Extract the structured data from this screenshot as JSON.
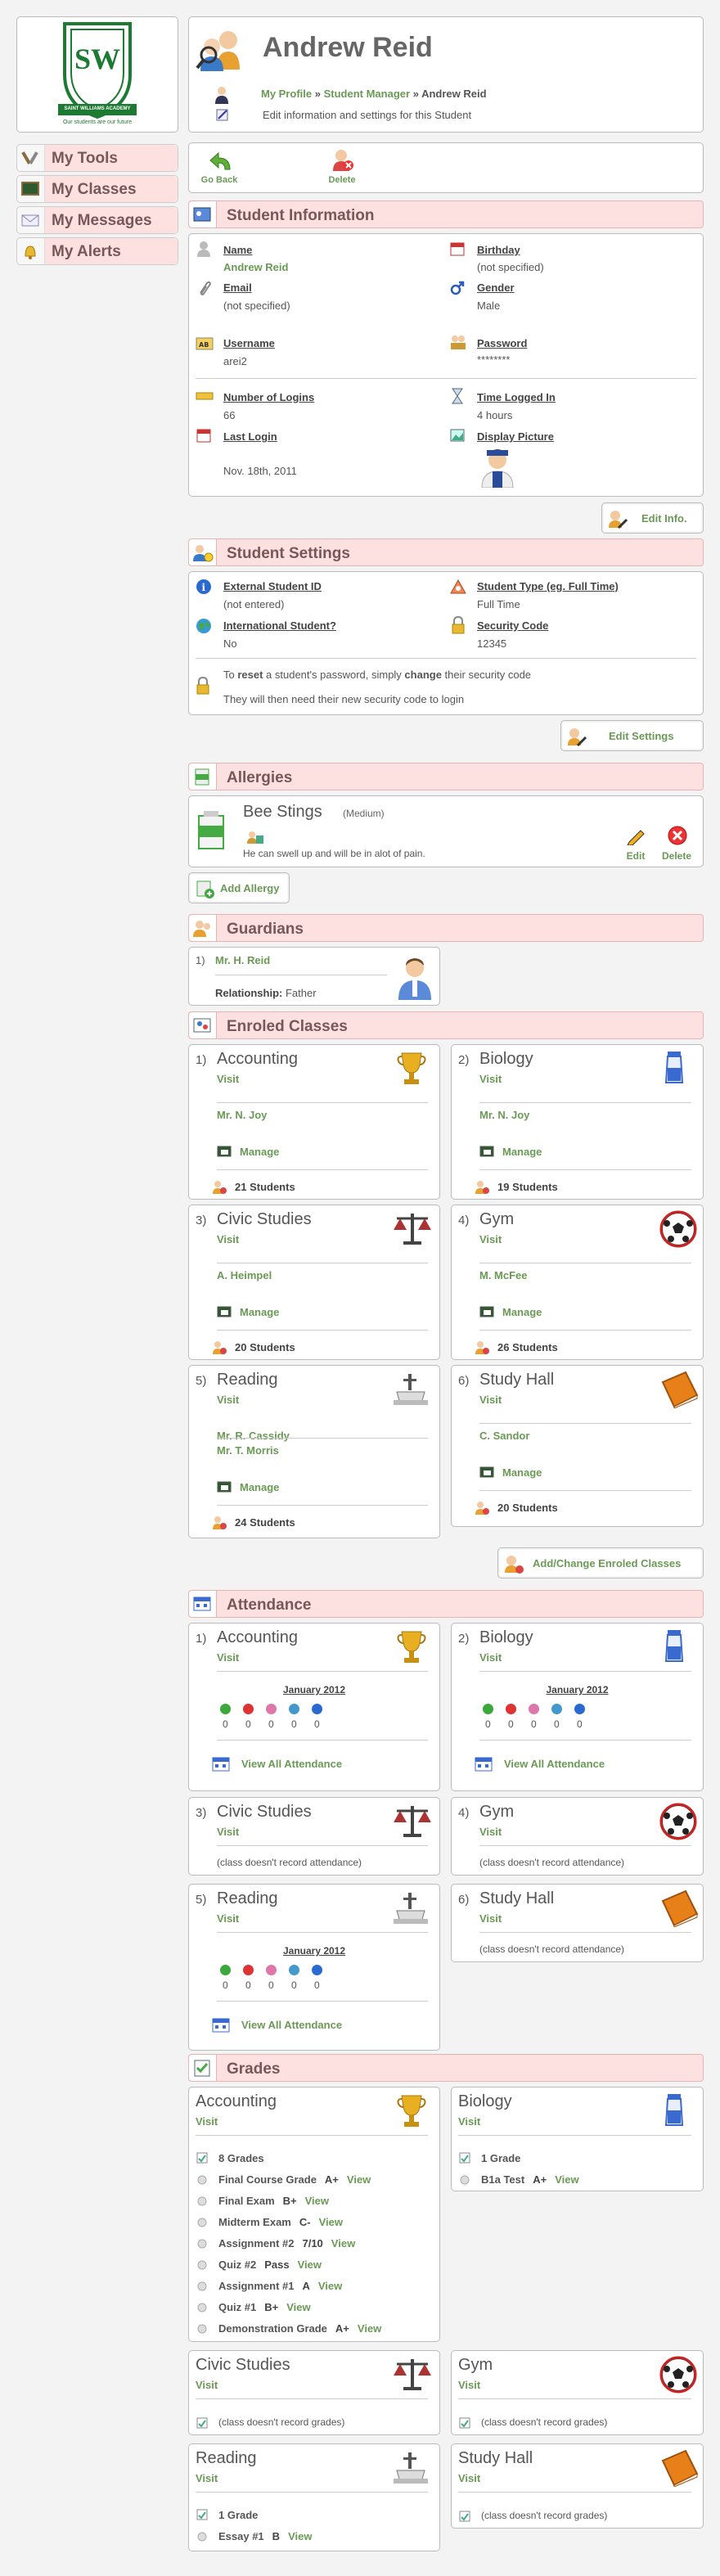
{
  "logo": {
    "letters": "SW",
    "banner": "SAINT WILLIAMS ACADEMY",
    "motto": "Our students are our future"
  },
  "nav": [
    {
      "label": "My Tools",
      "icon": "tools-icon"
    },
    {
      "label": "My Classes",
      "icon": "chalkboard-icon"
    },
    {
      "label": "My Messages",
      "icon": "envelope-icon"
    },
    {
      "label": "My Alerts",
      "icon": "bell-icon"
    }
  ],
  "header": {
    "name": "Andrew Reid",
    "breadcrumb": {
      "a": "My Profile",
      "sep1": "»",
      "b": "Student Manager",
      "sep2": "»",
      "c": "Andrew Reid"
    },
    "subtitle": "Edit information and settings for this Student"
  },
  "toolbar": {
    "back": "Go Back",
    "delete": "Delete"
  },
  "info": {
    "title": "Student Information",
    "name_label": "Name",
    "name_value": "Andrew Reid",
    "birthday_label": "Birthday",
    "birthday_value": "(not specified)",
    "email_label": "Email",
    "email_value": "(not specified)",
    "gender_label": "Gender",
    "gender_value": "Male",
    "username_label": "Username",
    "username_value": "arei2",
    "password_label": "Password",
    "password_value": "********",
    "logins_label": "Number of Logins",
    "logins_value": "66",
    "time_label": "Time Logged In",
    "time_value": "4 hours",
    "lastlogin_label": "Last Login",
    "lastlogin_value": "Nov. 18th, 2011",
    "picture_label": "Display Picture",
    "edit_button": "Edit Info."
  },
  "settings": {
    "title": "Student Settings",
    "ext_label": "External Student ID",
    "ext_value": "(not entered)",
    "type_label": "Student Type (eg. Full Time)",
    "type_value": "Full Time",
    "intl_label": "International Student?",
    "intl_value": "No",
    "code_label": "Security Code",
    "code_value": "12345",
    "note1a": "To ",
    "note1b": "reset",
    "note1c": " a student's password, simply ",
    "note1d": "change",
    "note1e": " their security code",
    "note2": "They will then need their new security code to login",
    "edit_button": "Edit Settings"
  },
  "allergies": {
    "title": "Allergies",
    "name": "Bee Stings",
    "severity": "(Medium)",
    "desc": "He can swell up and will be in alot of pain.",
    "edit": "Edit",
    "delete": "Delete",
    "add_button": "Add Allergy"
  },
  "guardians": {
    "title": "Guardians",
    "num": "1)",
    "name": "Mr. H. Reid",
    "rel_label": "Relationship:",
    "rel_value": "Father"
  },
  "classes": {
    "title": "Enroled Classes",
    "visit": "Visit",
    "manage": "Manage",
    "items": [
      {
        "num": "1)",
        "name": "Accounting",
        "teachers": "Mr. N. Joy",
        "teachers2": "",
        "students": "21 Students"
      },
      {
        "num": "2)",
        "name": "Biology",
        "teachers": "Mr. N. Joy",
        "teachers2": "",
        "students": "19 Students"
      },
      {
        "num": "3)",
        "name": "Civic Studies",
        "teachers": "A. Heimpel",
        "teachers2": "",
        "students": "20 Students"
      },
      {
        "num": "4)",
        "name": "Gym",
        "teachers": "M. McFee",
        "teachers2": "",
        "students": "26 Students"
      },
      {
        "num": "5)",
        "name": "Reading",
        "teachers": "Mr. R. Cassidy",
        "teachers2": "Mr. T. Morris",
        "students": "24 Students"
      },
      {
        "num": "6)",
        "name": "Study Hall",
        "teachers": "C. Sandor",
        "teachers2": "",
        "students": "20 Students"
      }
    ],
    "change_button": "Add/Change Enroled Classes"
  },
  "attendance": {
    "title": "Attendance",
    "month": "January 2012",
    "view_all": "View All Attendance",
    "no_record": "(class doesn't record attendance)",
    "counts": [
      "0",
      "0",
      "0",
      "0",
      "0"
    ],
    "items": [
      {
        "num": "1)",
        "name": "Accounting"
      },
      {
        "num": "2)",
        "name": "Biology"
      },
      {
        "num": "3)",
        "name": "Civic Studies"
      },
      {
        "num": "4)",
        "name": "Gym"
      },
      {
        "num": "5)",
        "name": "Reading"
      },
      {
        "num": "6)",
        "name": "Study Hall"
      }
    ]
  },
  "grades": {
    "title": "Grades",
    "no_record": "(class doesn't record grades)",
    "view": "View",
    "accounting": {
      "name": "Accounting",
      "count": "8 Grades",
      "rows": [
        {
          "n": "Final Course Grade",
          "g": "A+"
        },
        {
          "n": "Final Exam",
          "g": "B+"
        },
        {
          "n": "Midterm Exam",
          "g": "C-"
        },
        {
          "n": "Assignment #2",
          "g": "7/10"
        },
        {
          "n": "Quiz #2",
          "g": "Pass"
        },
        {
          "n": "Assignment #1",
          "g": "A"
        },
        {
          "n": "Quiz #1",
          "g": "B+"
        },
        {
          "n": "Demonstration Grade",
          "g": "A+"
        }
      ]
    },
    "biology": {
      "name": "Biology",
      "count": "1 Grade",
      "row_n": "B1a Test",
      "row_g": "A+"
    },
    "civic": {
      "name": "Civic Studies"
    },
    "gym": {
      "name": "Gym"
    },
    "reading": {
      "name": "Reading",
      "count": "1 Grade",
      "row_n": "Essay #1",
      "row_g": "B"
    },
    "studyhall": {
      "name": "Study Hall"
    }
  }
}
